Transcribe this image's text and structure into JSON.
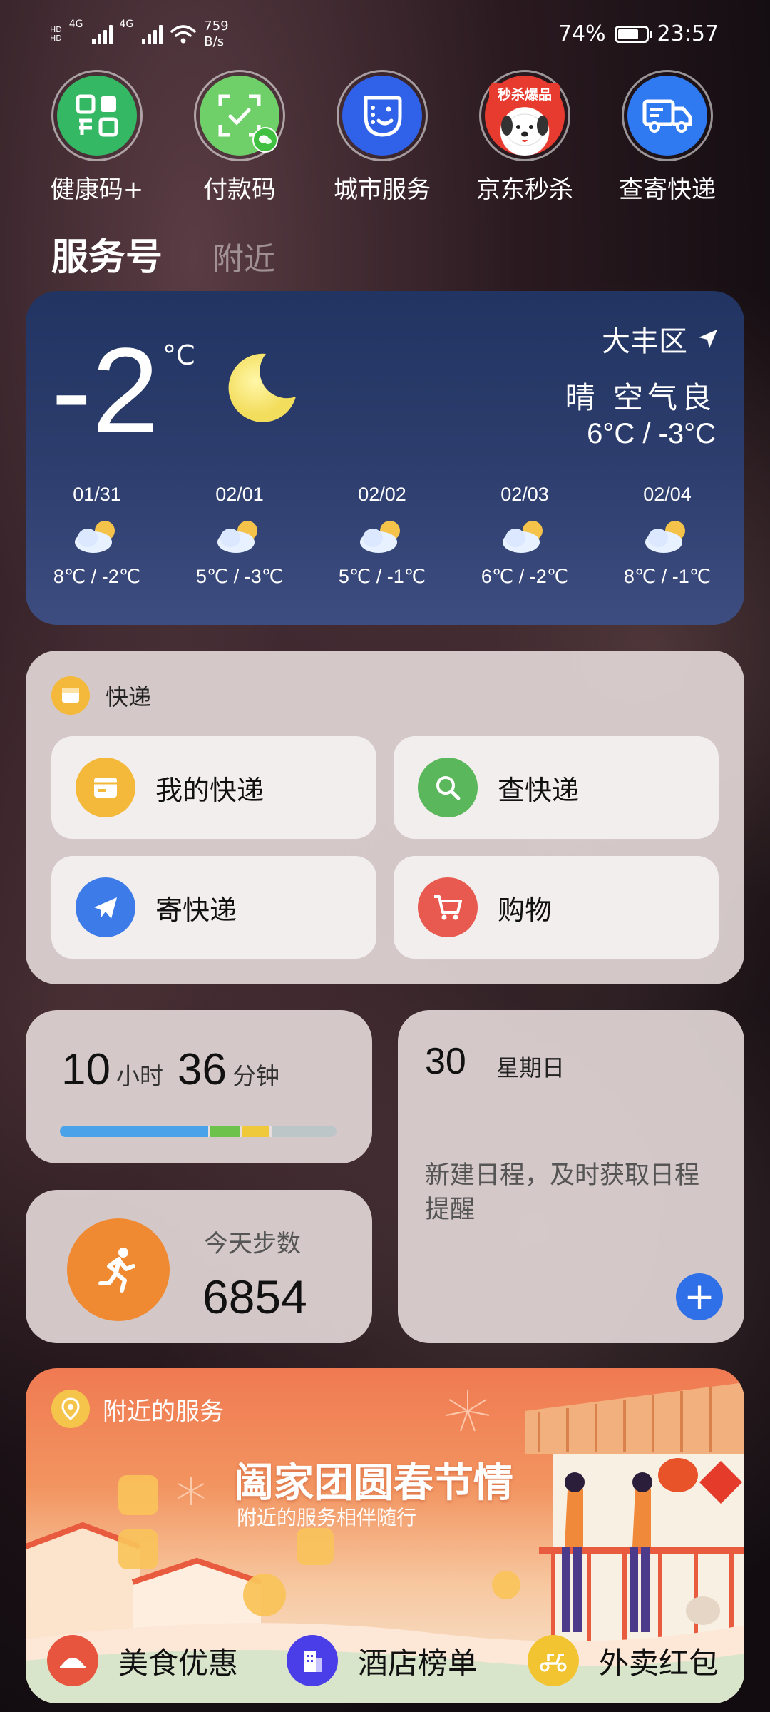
{
  "status": {
    "net1": "4G",
    "net2": "4G",
    "hd1": "HD",
    "hd2": "HD",
    "speed_value": "759",
    "speed_unit": "B/s",
    "battery": "74%",
    "battery_level": 0.74,
    "time": "23:57"
  },
  "apps": [
    {
      "label": "健康码+",
      "icon": "health-code-icon",
      "color": "#35b864"
    },
    {
      "label": "付款码",
      "icon": "payment-code-icon",
      "color": "#6fd06a"
    },
    {
      "label": "城市服务",
      "icon": "city-service-icon",
      "color": "#2f62e8"
    },
    {
      "label": "京东秒杀",
      "icon": "jd-seckill-icon",
      "color": "#e63b2e",
      "badge": "秒杀爆品"
    },
    {
      "label": "查寄快递",
      "icon": "delivery-truck-icon",
      "color": "#2f7af0"
    }
  ],
  "tabs": {
    "active": "服务号",
    "other": "附近"
  },
  "weather": {
    "temp": "-2",
    "unit": "°C",
    "location": "大丰区",
    "condition": "晴 空气良",
    "range": "6°C / -3°C",
    "forecast": [
      {
        "date": "01/31",
        "range": "8℃ / -2℃"
      },
      {
        "date": "02/01",
        "range": "5℃ / -3℃"
      },
      {
        "date": "02/02",
        "range": "5℃ / -1℃"
      },
      {
        "date": "02/03",
        "range": "6℃ / -2℃"
      },
      {
        "date": "02/04",
        "range": "8℃ / -1℃"
      }
    ]
  },
  "express": {
    "title": "快递",
    "buttons": [
      {
        "label": "我的快递",
        "color": "#f4b93a"
      },
      {
        "label": "查快递",
        "color": "#5bb75b"
      },
      {
        "label": "寄快递",
        "color": "#3d7ce8"
      },
      {
        "label": "购物",
        "color": "#e85a4f"
      }
    ]
  },
  "sleep": {
    "hours": "10",
    "hours_unit": "小时",
    "minutes": "36",
    "minutes_unit": "分钟",
    "segments": [
      {
        "fraction": 0.55,
        "color": "#4aa3e8"
      },
      {
        "fraction": 0.11,
        "color": "#6cc24a"
      },
      {
        "fraction": 0.1,
        "color": "#f0c93a"
      },
      {
        "fraction": 0.24,
        "color": "#bcc6c8"
      }
    ]
  },
  "steps": {
    "label": "今天步数",
    "value": "6854"
  },
  "calendar": {
    "day": "30",
    "weekday": "星期日",
    "hint": "新建日程，及时获取日程提醒",
    "add": "+"
  },
  "nearby": {
    "title": "附近的服务",
    "banner_title": "阖家团圆春节情",
    "banner_sub": "附近的服务相伴随行",
    "items": [
      {
        "label": "美食优惠",
        "color": "#e8553e"
      },
      {
        "label": "酒店榜单",
        "color": "#4a3ee8"
      },
      {
        "label": "外卖红包",
        "color": "#f2c431"
      }
    ]
  }
}
